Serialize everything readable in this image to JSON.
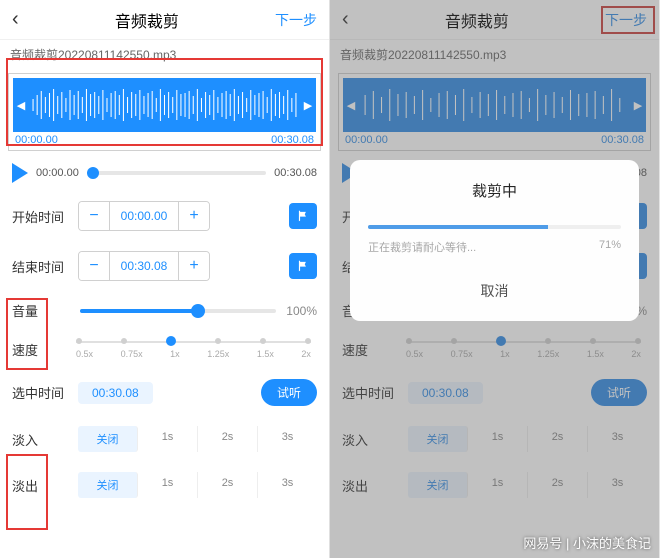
{
  "header": {
    "title": "音频裁剪",
    "next": "下一步"
  },
  "filename": "音频裁剪20220811142550.mp3",
  "wave": {
    "start": "00:00.00",
    "end": "00:30.08"
  },
  "play": {
    "current": "00:00.00",
    "total": "00:30.08"
  },
  "startTime": {
    "label": "开始时间",
    "value": "00:00.00"
  },
  "endTime": {
    "label": "结束时间",
    "value": "00:30.08"
  },
  "volume": {
    "label": "音量",
    "value": "100%"
  },
  "speed": {
    "label": "速度",
    "options": [
      "0.5x",
      "0.75x",
      "1x",
      "1.25x",
      "1.5x",
      "2x"
    ]
  },
  "selected": {
    "label": "选中时间",
    "value": "00:30.08",
    "try": "试听"
  },
  "fadeIn": {
    "label": "淡入"
  },
  "fadeOut": {
    "label": "淡出"
  },
  "fadeOpts": [
    "关闭",
    "1s",
    "2s",
    "3s"
  ],
  "dialog": {
    "title": "裁剪中",
    "msg": "正在裁剪请耐心等待...",
    "pct": "71%",
    "cancel": "取消"
  },
  "watermark": "网易号 | 小沫的美食记"
}
